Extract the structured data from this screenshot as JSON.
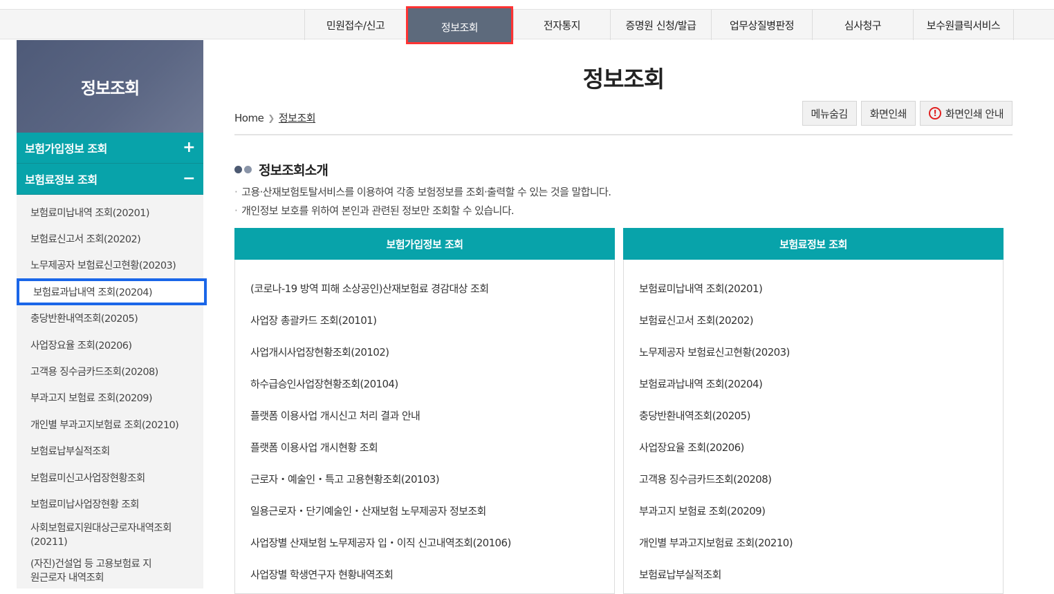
{
  "topnav": {
    "items": [
      {
        "label": "민원접수/신고",
        "active": false
      },
      {
        "label": "정보조회",
        "active": true
      },
      {
        "label": "전자통지",
        "active": false
      },
      {
        "label": "증명원 신청/발급",
        "active": false
      },
      {
        "label": "업무상질병판정",
        "active": false
      },
      {
        "label": "심사청구",
        "active": false
      },
      {
        "label": "보수원클릭서비스",
        "active": false
      }
    ]
  },
  "sidebar": {
    "title": "정보조회",
    "categories": [
      {
        "label": "보험가입정보 조회",
        "sign": "+"
      },
      {
        "label": "보험료정보 조회",
        "sign": "−"
      }
    ],
    "items": [
      "보험료미납내역 조회(20201)",
      "보험료신고서 조회(20202)",
      "노무제공자 보험료신고현황(20203)",
      "보험료과납내역 조회(20204)",
      "충당반환내역조회(20205)",
      "사업장요율 조회(20206)",
      "고객용 징수금카드조회(20208)",
      "부과고지 보험료 조회(20209)",
      "개인별 부과고지보험료 조회(20210)",
      "보험료납부실적조회",
      "보험료미신고사업장현황조회",
      "보험료미납사업장현황 조회",
      "사회보험료지원대상근로자내역조회(20211)",
      "(자진)건설업 등 고용보험료 지원근로자 내역조회"
    ]
  },
  "main": {
    "title": "정보조회",
    "breadcrumb": {
      "home": "Home",
      "current": "정보조회"
    },
    "tools": {
      "hide_menu": "메뉴숨김",
      "print": "화면인쇄",
      "print_guide": "화면인쇄 안내"
    },
    "section_title": "정보조회소개",
    "descriptions": [
      "고용·산재보험토탈서비스를 이용하여 각종 보험정보를 조회·출력할 수 있는 것을 말합니다.",
      "개인정보 보호를 위하여 본인과 관련된 정보만 조회할 수 있습니다."
    ],
    "panels": [
      {
        "title": "보험가입정보 조회",
        "items": [
          "(코로나-19 방역 피해 소상공인)산재보험료 경감대상 조회",
          "사업장 총괄카드 조회(20101)",
          "사업개시사업장현황조회(20102)",
          "하수급승인사업장현황조회(20104)",
          "플랫폼 이용사업 개시신고 처리 결과 안내",
          "플랫폼 이용사업 개시현황 조회",
          "근로자・예술인・특고 고용현황조회(20103)",
          "일용근로자・단기예술인・산재보험 노무제공자 정보조회",
          "사업장별 산재보험 노무제공자 입・이직 신고내역조회(20106)",
          "사업장별 학생연구자 현황내역조회"
        ]
      },
      {
        "title": "보험료정보 조회",
        "items": [
          "보험료미납내역 조회(20201)",
          "보험료신고서 조회(20202)",
          "노무제공자 보험료신고현황(20203)",
          "보험료과납내역 조회(20204)",
          "충당반환내역조회(20205)",
          "사업장요율 조회(20206)",
          "고객용 징수금카드조회(20208)",
          "부과고지 보험료 조회(20209)",
          "개인별 부과고지보험료 조회(20210)",
          "보험료납부실적조회"
        ]
      }
    ]
  }
}
